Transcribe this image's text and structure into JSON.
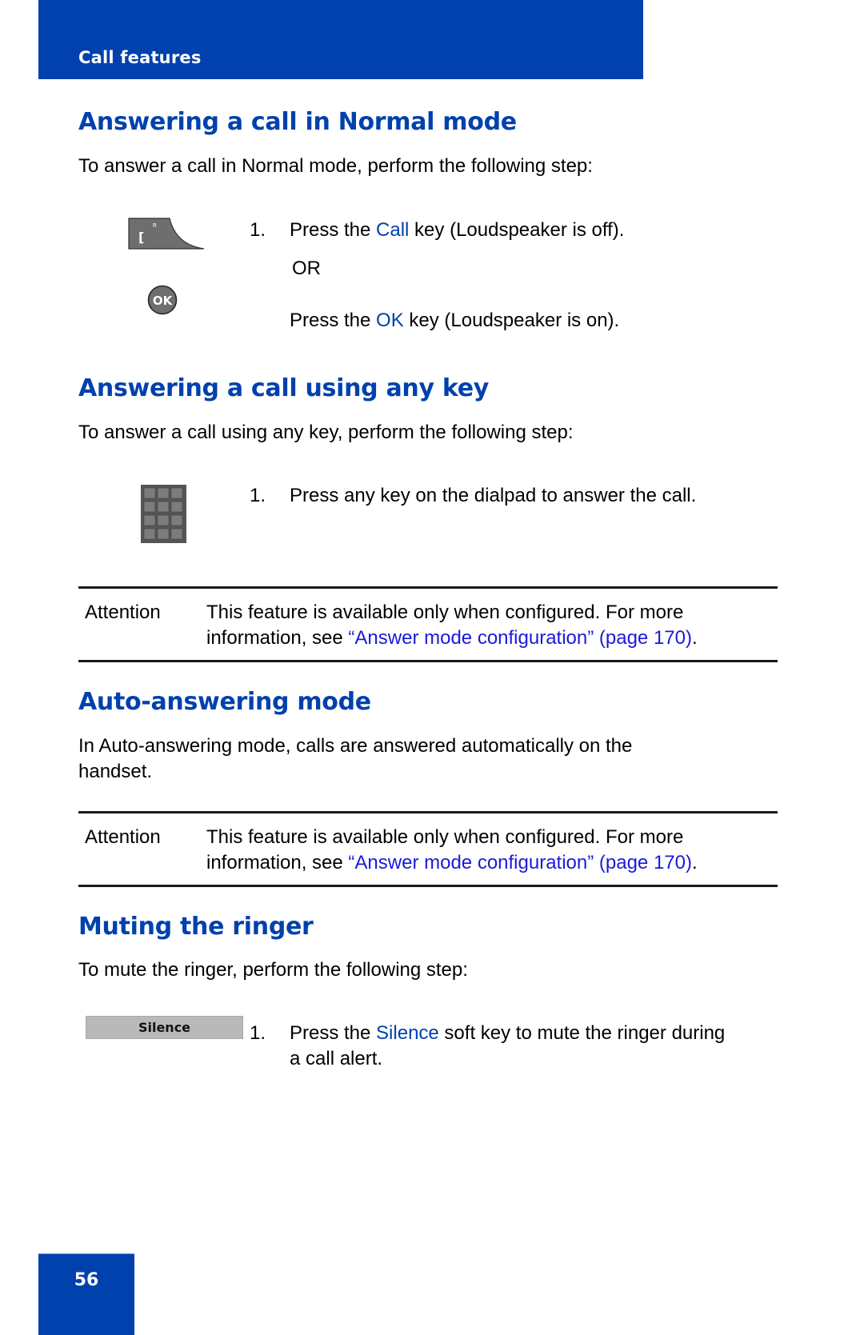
{
  "header": {
    "section_title": "Call features"
  },
  "sections": {
    "normal_mode": {
      "heading": "Answering a call in Normal mode",
      "intro": "To answer a call in Normal mode, perform the following step:",
      "step1": {
        "number": "1.",
        "prefix": "Press the ",
        "keyword": "Call",
        "suffix": " key (Loudspeaker is off)."
      },
      "or_label": "OR",
      "step1_alt": {
        "prefix": "Press the ",
        "keyword": "OK",
        "suffix": " key (Loudspeaker is on)."
      },
      "icons": {
        "call_key_labels": {
          "top": "R",
          "main": "["
        },
        "ok_key_label": "OK"
      }
    },
    "any_key": {
      "heading": "Answering a call using any key",
      "intro": "To answer a call using any key, perform the following step:",
      "step1": {
        "number": "1.",
        "text": "Press any key on the dialpad to answer the call."
      },
      "attention": {
        "label": "Attention",
        "text_before": "This feature is available only when configured. For more information, see ",
        "link_text": "“Answer mode configuration” (page 170)",
        "text_after": "."
      }
    },
    "auto_answer": {
      "heading": "Auto-answering mode",
      "intro_line1": "In Auto-answering mode, calls are answered automatically on the",
      "intro_line2": "handset.",
      "attention": {
        "label": "Attention",
        "text_before": "This feature is available only when configured. For more information, see ",
        "link_text": "“Answer mode configuration” (page 170)",
        "text_after": "."
      }
    },
    "mute_ringer": {
      "heading": "Muting the ringer",
      "intro": "To mute the ringer, perform the following step:",
      "softkey_label": "Silence",
      "step1": {
        "number": "1.",
        "prefix": "Press the ",
        "keyword": "Silence",
        "suffix": " soft key to mute the ringer during",
        "line2": "a call alert."
      }
    }
  },
  "footer": {
    "page_number": "56"
  },
  "colors": {
    "brand_blue": "#0041ad",
    "link_blue": "#1a1adb",
    "key_gray": "#6e6e6e"
  }
}
